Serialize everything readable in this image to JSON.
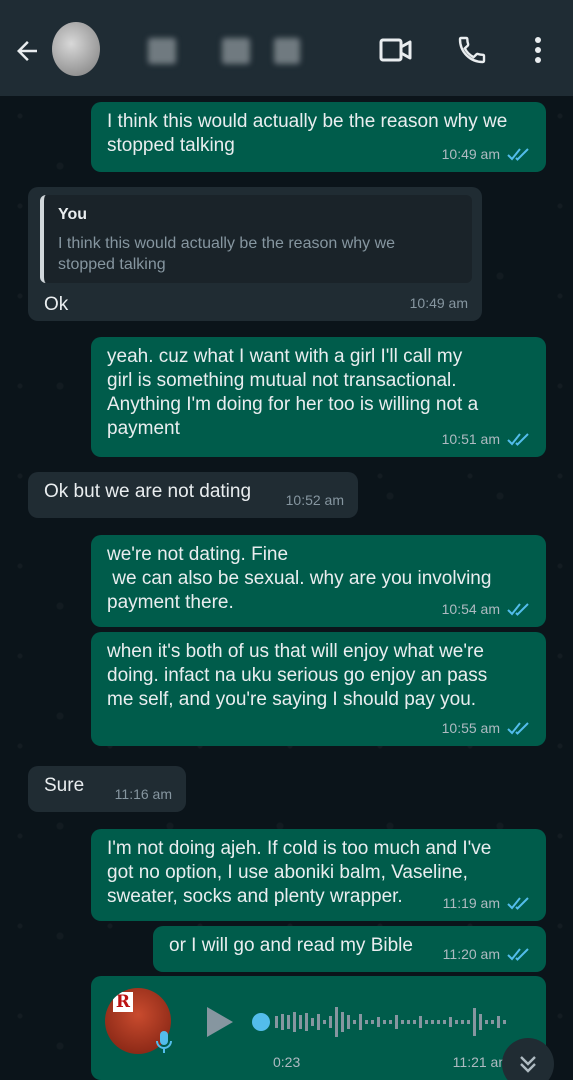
{
  "header": {
    "back_icon": "arrow-left-icon",
    "video_icon": "video-camera-icon",
    "call_icon": "phone-icon",
    "menu_icon": "more-vertical-icon"
  },
  "colors": {
    "header_bg": "#1f2c34",
    "chat_bg": "#0b141a",
    "outgoing_bubble": "#005c4b",
    "incoming_bubble": "#202c33",
    "read_ticks": "#53bdeb"
  },
  "messages": [
    {
      "text": "I think this would actually be the reason why we\nstopped talking",
      "time": "10:49 am"
    },
    {
      "quote_author": "You",
      "quote_text": "I think this would actually be the reason why we\nstopped talking",
      "text": "Ok",
      "time": "10:49 am"
    },
    {
      "text": "yeah. cuz what I want with a girl I'll call my\ngirl is something mutual not transactional.\nAnything I'm doing for her too is willing not a\npayment",
      "time": "10:51 am"
    },
    {
      "text": "Ok but we are not dating",
      "time": "10:52 am"
    },
    {
      "text": "we're not dating. Fine\n we can also be sexual. why are you involving\npayment there.",
      "time": "10:54 am"
    },
    {
      "text": "when it's both of us that will enjoy what we're\ndoing. infact na uku serious go enjoy an pass\nme self, and you're saying I should pay you.",
      "time": "10:55 am"
    },
    {
      "text": "Sure",
      "time": "11:16 am"
    },
    {
      "text": "I'm not doing ajeh. If cold is too much and I've\ngot no option, I use aboniki balm, Vaseline,\nsweater, socks and plenty wrapper.",
      "time": "11:19 am"
    },
    {
      "text": "or I will go and read my Bible",
      "time": "11:20 am"
    }
  ],
  "voice_note": {
    "duration": "0:23",
    "time": "11:21 am",
    "thumb_letter": "R",
    "play_icon": "play-icon",
    "mic_icon": "microphone-icon"
  },
  "scroll_icon": "double-chevron-down-icon"
}
